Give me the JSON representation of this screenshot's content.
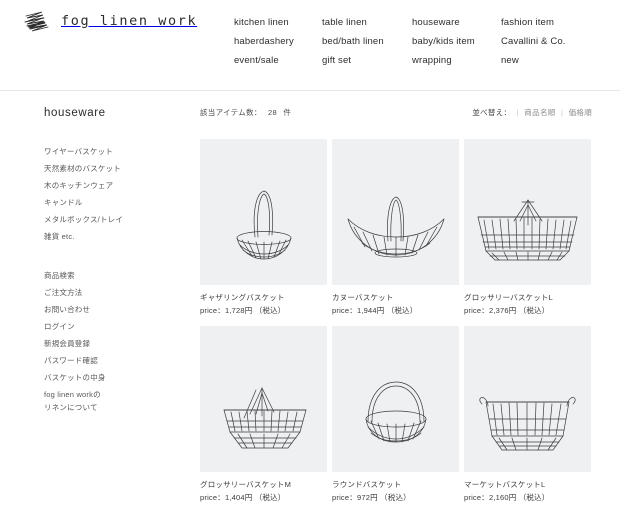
{
  "header": {
    "logo_icon": "scribble-mark-icon",
    "brand": "fog linen work",
    "nav": [
      "kitchen linen",
      "table linen",
      "houseware",
      "fashion item",
      "haberdashery",
      "bed/bath linen",
      "baby/kids item",
      "Cavallini & Co.",
      "event/sale",
      "gift set",
      "wrapping",
      "new"
    ]
  },
  "sidebar": {
    "title": "houseware",
    "categories": [
      "ワイヤーバスケット",
      "天然素材のバスケット",
      "木のキッチンウェア",
      "キャンドル",
      "メタルボックス/トレイ",
      "雑貨 etc."
    ],
    "utility": [
      "商品検索",
      "ご注文方法",
      "お問い合わせ",
      "ログイン",
      "新規会員登録",
      "パスワード確認",
      "バスケットの中身"
    ],
    "utility_last": "fog linen workの\nリネンについて"
  },
  "main": {
    "count_label": "該当アイテム数：",
    "count_value": "28",
    "count_unit": "件",
    "sort_label": "並べ替え：",
    "sort_options": [
      "商品名順",
      "価格順"
    ],
    "products": [
      {
        "name": "ギャザリングバスケット",
        "price": "price：1,728円 （税込）",
        "image": "gathering-basket-wire"
      },
      {
        "name": "カヌーバスケット",
        "price": "price：1,944円 （税込）",
        "image": "canoe-basket-wire"
      },
      {
        "name": "グロッサリーバスケットL",
        "price": "price：2,376円 （税込）",
        "image": "grocery-basket-l-wire"
      },
      {
        "name": "グロッサリーバスケットM",
        "price": "price：1,404円 （税込）",
        "image": "grocery-basket-m-wire"
      },
      {
        "name": "ラウンドバスケット",
        "price": "price：972円 （税込）",
        "image": "round-basket-wire"
      },
      {
        "name": "マーケットバスケットL",
        "price": "price：2,160円 （税込）",
        "image": "market-basket-l-wire"
      }
    ]
  },
  "colors": {
    "text": "#3a3a3a",
    "muted": "#8a8a8a",
    "thumb_bg": "#eef0f1",
    "rule": "#e6e6e6"
  }
}
